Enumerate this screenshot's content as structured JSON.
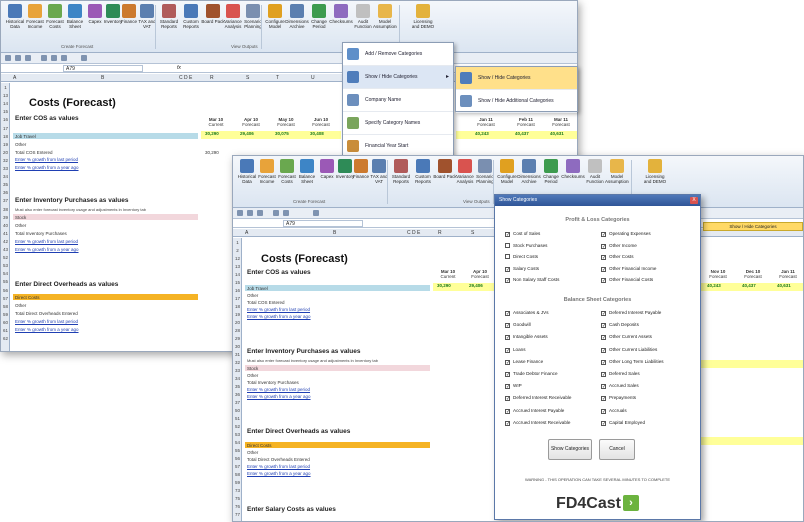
{
  "back": {
    "ribbon": [
      "Historical Data",
      "Forecast Income",
      "Forecast Costs",
      "Balance Sheet",
      "Capex",
      "Inventory",
      "Finance",
      "TAX and VAT",
      "Standard Reports",
      "Custom Reports",
      "Board Pack",
      "Variance Analysis",
      "Scenario Planning",
      "Configure Model",
      "Dimensions Archive",
      "Change Period",
      "Checksums",
      "Audit Function",
      "Model Assumptions",
      "Licensing and DEMO"
    ],
    "groups": [
      "Create Forecast",
      "View Outputs",
      "Licensing"
    ],
    "cell_ref": "A79",
    "columns": [
      "A",
      "B",
      "C D E",
      "R",
      "S",
      "T",
      "U",
      "AD",
      "AE"
    ],
    "title": "Costs (Forecast)",
    "sections": [
      "Enter COS as values",
      "Enter Inventory Purchases as values",
      "Enter Direct Overheads as values"
    ],
    "inv_sub": "Must also enter forecast inventory usage and adjustments in Inventory tab",
    "cos_rows": [
      "Job Travel",
      "Other",
      "Total COS Entered"
    ],
    "inv_rows": [
      "Stock",
      "Other",
      "Total Inventory Purchases"
    ],
    "oh_rows": [
      "Direct Costs",
      "Other",
      "Total Direct Overheads Entered"
    ],
    "link1": "Enter % growth from last period",
    "link2": "Enter % growth from a year ago",
    "period_hdr": [
      "Mar 10",
      "Apr 10",
      "May 10",
      "Jun 10",
      "Jan 11",
      "Feb 11",
      "Mar 11"
    ],
    "period_sub": [
      "Current",
      "Forecast",
      "Forecast",
      "Forecast",
      "Forecast",
      "Forecast",
      "Forecast"
    ],
    "job_travel": [
      "30,290",
      "29,406",
      "30,075",
      "30,408",
      "40,243",
      "40,437",
      "40,631"
    ],
    "total_cos": "30,290",
    "row_numbers": [
      "1",
      "13",
      "14",
      "15",
      "16",
      "17",
      "18",
      "19",
      "20",
      "32",
      "33",
      "34",
      "35",
      "36",
      "37",
      "38",
      "39",
      "40",
      "41",
      "42",
      "43",
      "52",
      "53",
      "54",
      "55",
      "56",
      "57",
      "58",
      "59",
      "60",
      "61",
      "62"
    ]
  },
  "menu": {
    "items": [
      "Add / Remove Categories",
      "Show / Hide Categories",
      "Company Name",
      "Specify Category Names",
      "Financial Year Start"
    ],
    "sub_items": [
      "Show / Hide Categories",
      "Show / Hide Additional Categories"
    ]
  },
  "front": {
    "ribbon": [
      "Historical Data",
      "Forecast Income",
      "Forecast Costs",
      "Balance Sheet",
      "Capex",
      "Inventory",
      "Finance",
      "TAX and VAT",
      "Standard Reports",
      "Custom Reports",
      "Board Pack",
      "Variance Analysis",
      "Scenario Planning",
      "Configure Model",
      "Dimensions Archive",
      "Change Period",
      "Checksums",
      "Audit Function",
      "Model Assumptions",
      "Licensing and DEMO"
    ],
    "groups": [
      "Create Forecast",
      "View Outputs",
      "Licensing"
    ],
    "cell_ref": "A79",
    "columns": [
      "A",
      "B",
      "C D E",
      "R",
      "S"
    ],
    "title": "Costs (Forecast)",
    "sections": [
      "Enter COS as values",
      "Enter Inventory Purchases as values",
      "Enter Direct Overheads as values",
      "Enter Salary Costs as values"
    ],
    "inv_sub": "Must also enter forecast inventory usage and adjustments in Inventory tab",
    "cos_rows": [
      "Job Travel",
      "Other",
      "Total COS Entered"
    ],
    "inv_rows": [
      "Stock",
      "Other",
      "Total Inventory Purchases"
    ],
    "oh_rows": [
      "Direct Costs",
      "Other",
      "Total Direct Overheads Entered"
    ],
    "link1": "Enter % growth from last period",
    "link2": "Enter % growth from a year ago",
    "period_hdr": [
      "Mar 10",
      "Apr 10",
      "Nov 10",
      "Dec 10",
      "Jan 11"
    ],
    "period_sub": [
      "Current",
      "Forecast",
      "Forecast",
      "Forecast",
      "Forecast"
    ],
    "job_travel": [
      "30,290",
      "29,406",
      "40,243",
      "40,437",
      "40,631"
    ],
    "tip": "Show / Hide Categories",
    "row_numbers": [
      "1",
      "2",
      "12",
      "13",
      "14",
      "15",
      "16",
      "17",
      "18",
      "19",
      "20",
      "28",
      "29",
      "30",
      "31",
      "32",
      "33",
      "34",
      "35",
      "36",
      "37",
      "50",
      "51",
      "52",
      "53",
      "54",
      "55",
      "56",
      "57",
      "58",
      "59",
      "73",
      "75",
      "76",
      "77"
    ]
  },
  "dialog": {
    "title": "Show Categories",
    "close": "X",
    "pl_heading": "Profit & Loss Categories",
    "pl_left": [
      [
        "Cost of Sales",
        true
      ],
      [
        "Stock Purchases",
        false
      ],
      [
        "Direct Costs",
        false
      ],
      [
        "Salary Costs",
        true
      ],
      [
        "Non Salary Staff Costs",
        true
      ]
    ],
    "pl_right": [
      [
        "Operating Expenses",
        true
      ],
      [
        "Other Income",
        true
      ],
      [
        "Other Costs",
        true
      ],
      [
        "Other Financial Income",
        true
      ],
      [
        "Other Financial Costs",
        true
      ]
    ],
    "bs_heading": "Balance Sheet Categories",
    "bs_left": [
      [
        "Associates & JVs",
        true
      ],
      [
        "Goodwill",
        true
      ],
      [
        "Intangible Assets",
        true
      ],
      [
        "Loans",
        true
      ],
      [
        "Lease Finance",
        true
      ],
      [
        "Trade Debtor Finance",
        true
      ],
      [
        "WIP",
        true
      ],
      [
        "Deferred Interest Receivable",
        true
      ],
      [
        "Accrued Interest Payable",
        true
      ],
      [
        "Accrued Interest Receivable",
        true
      ]
    ],
    "bs_right": [
      [
        "Deferred Interest Payable",
        true
      ],
      [
        "Cash Deposits",
        true
      ],
      [
        "Other Current Assets",
        true
      ],
      [
        "Other Current Liabilities",
        true
      ],
      [
        "Other Long Term Liabilities",
        true
      ],
      [
        "Deferred Sales",
        true
      ],
      [
        "Accrued Sales",
        true
      ],
      [
        "Prepayments",
        true
      ],
      [
        "Accruals",
        true
      ],
      [
        "Capital Employed",
        true
      ]
    ],
    "show_btn": "Show Categories",
    "cancel_btn": "Cancel",
    "warning": "WARNING - THIS OPERATION CAN TAKE SEVERAL MINUTES TO COMPLETE",
    "logo": "FD4Cast",
    "logo_mark": "›"
  },
  "colors": {
    "accent": "#2f5597",
    "yellow": "#ffff99",
    "blue_bar": "#b7dbe8",
    "pink_bar": "#f2d7dc",
    "orange_bar": "#f5b324",
    "link": "#1f3fb3",
    "logo_green": "#6cb33f"
  }
}
